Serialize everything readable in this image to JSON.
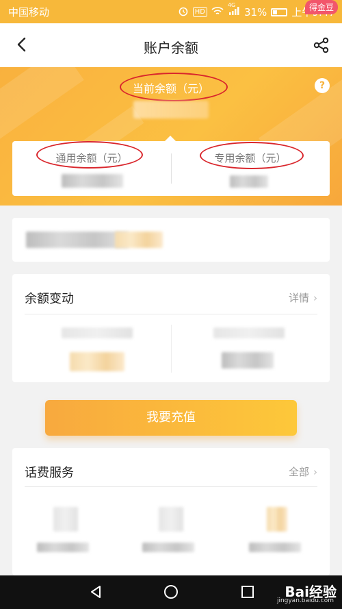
{
  "status_bar": {
    "carrier": "中国移动",
    "hd": "HD",
    "network": "4G",
    "battery": "31%",
    "time": "上午9:47"
  },
  "header": {
    "title": "账户余额",
    "badge": "得金豆"
  },
  "hero": {
    "current_label": "当前余额（元）",
    "help": "?"
  },
  "balances": {
    "general_label": "通用余额（元）",
    "special_label": "专用余额（元）"
  },
  "changes": {
    "title": "余额变动",
    "link": "详情"
  },
  "recharge": {
    "label": "我要充值"
  },
  "services": {
    "title": "话费服务",
    "link": "全部"
  },
  "watermark": {
    "brand": "Bai经验",
    "url": "jingyan.baidu.com"
  },
  "colors": {
    "accent": "#f9b13e",
    "annotation": "#d9262c",
    "badge": "#f2566b"
  }
}
